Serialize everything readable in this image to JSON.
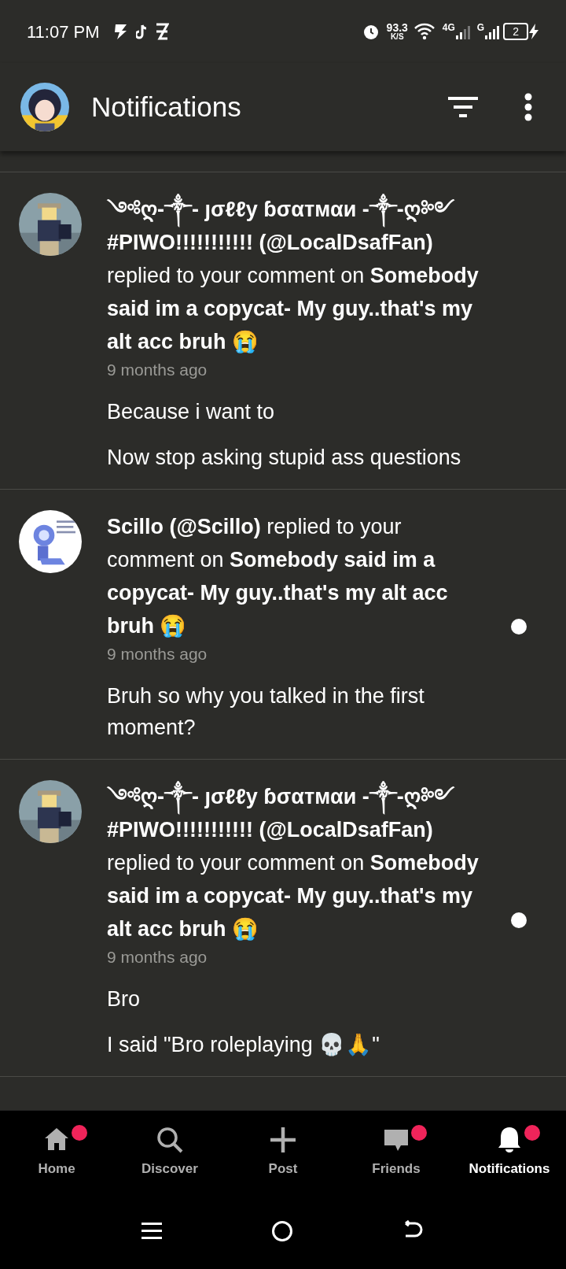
{
  "status_bar": {
    "time": "11:07 PM",
    "speed": "93.3",
    "speed_unit": "K/S",
    "network_1": "4G",
    "network_2": "G",
    "battery": "2"
  },
  "app_bar": {
    "title": "Notifications"
  },
  "notifications": [
    {
      "message": "**༺ღ-༒- ȷσℓℓу ɓσαтмαи -༒-ღ༻ #PIWO!!!!!!!!!!! (@LocalDsafFan)** replied to your comment on **Somebody said im a copycat- My guy..that's my alt acc bruh 😭**",
      "time": "9 months ago",
      "replies": [
        "Because i want to",
        "Now stop asking stupid ass questions"
      ],
      "unread": false
    },
    {
      "message": "**Scillo (@Scillo)** replied to your comment on **Somebody said im a copycat- My guy..that's my alt acc bruh 😭**",
      "time": "9 months ago",
      "replies": [
        "Bruh so why you talked in the first moment?"
      ],
      "unread": true
    },
    {
      "message": "**༺ღ-༒- ȷσℓℓу ɓσαтмαи -༒-ღ༻ #PIWO!!!!!!!!!!! (@LocalDsafFan)** replied to your comment on **Somebody said im a copycat- My guy..that's my alt acc bruh 😭**",
      "time": "9 months ago",
      "replies": [
        "Bro",
        "I said \"Bro roleplaying 💀🙏\""
      ],
      "unread": true
    }
  ],
  "bottom_nav": [
    {
      "label": "Home",
      "kind": "home",
      "badge": true,
      "selected": false
    },
    {
      "label": "Discover",
      "kind": "search",
      "badge": false,
      "selected": false
    },
    {
      "label": "Post",
      "kind": "plus",
      "badge": false,
      "selected": false
    },
    {
      "label": "Friends",
      "kind": "chat",
      "badge": true,
      "selected": false
    },
    {
      "label": "Notifications",
      "kind": "bell",
      "badge": true,
      "selected": true
    }
  ]
}
